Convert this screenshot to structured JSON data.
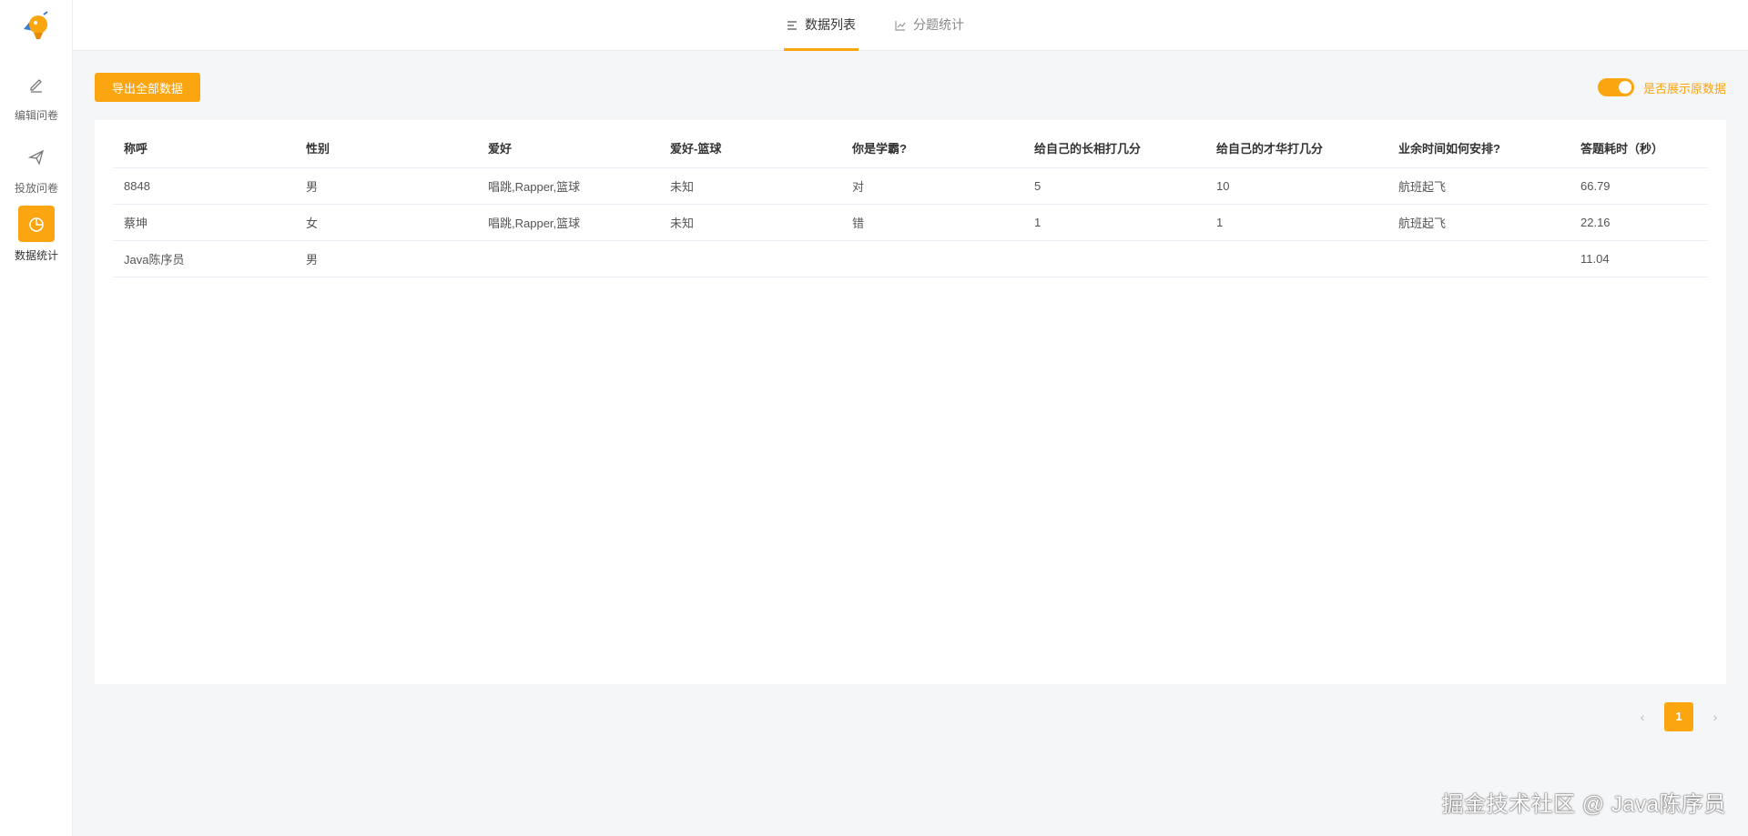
{
  "colors": {
    "accent": "#fba510",
    "background": "#f5f6f8"
  },
  "sidebar": {
    "items": [
      {
        "label": "编辑问卷",
        "icon": "edit-icon",
        "active": false
      },
      {
        "label": "投放问卷",
        "icon": "send-icon",
        "active": false
      },
      {
        "label": "数据统计",
        "icon": "pie-chart-icon",
        "active": true
      }
    ]
  },
  "tabs": [
    {
      "label": "数据列表",
      "icon": "list-icon",
      "active": true
    },
    {
      "label": "分题统计",
      "icon": "line-chart-icon",
      "active": false
    }
  ],
  "toolbar": {
    "export_label": "导出全部数据",
    "toggle_label": "是否展示原数据",
    "toggle_on": true
  },
  "table": {
    "columns": [
      "称呼",
      "性别",
      "爱好",
      "爱好-篮球",
      "你是学霸?",
      "给自己的长相打几分",
      "给自己的才华打几分",
      "业余时间如何安排?",
      "答题耗时（秒）"
    ],
    "rows": [
      [
        "8848",
        "男",
        "唱跳,Rapper,篮球",
        "未知",
        "对",
        "5",
        "10",
        "航班起飞",
        "66.79"
      ],
      [
        "蔡坤",
        "女",
        "唱跳,Rapper,篮球",
        "未知",
        "错",
        "1",
        "1",
        "航班起飞",
        "22.16"
      ],
      [
        "Java陈序员",
        "男",
        "",
        "",
        "",
        "",
        "",
        "",
        "11.04"
      ]
    ]
  },
  "pagination": {
    "prev": "‹",
    "current": "1",
    "next": "›"
  },
  "watermark": "掘金技术社区 @ Java陈序员"
}
